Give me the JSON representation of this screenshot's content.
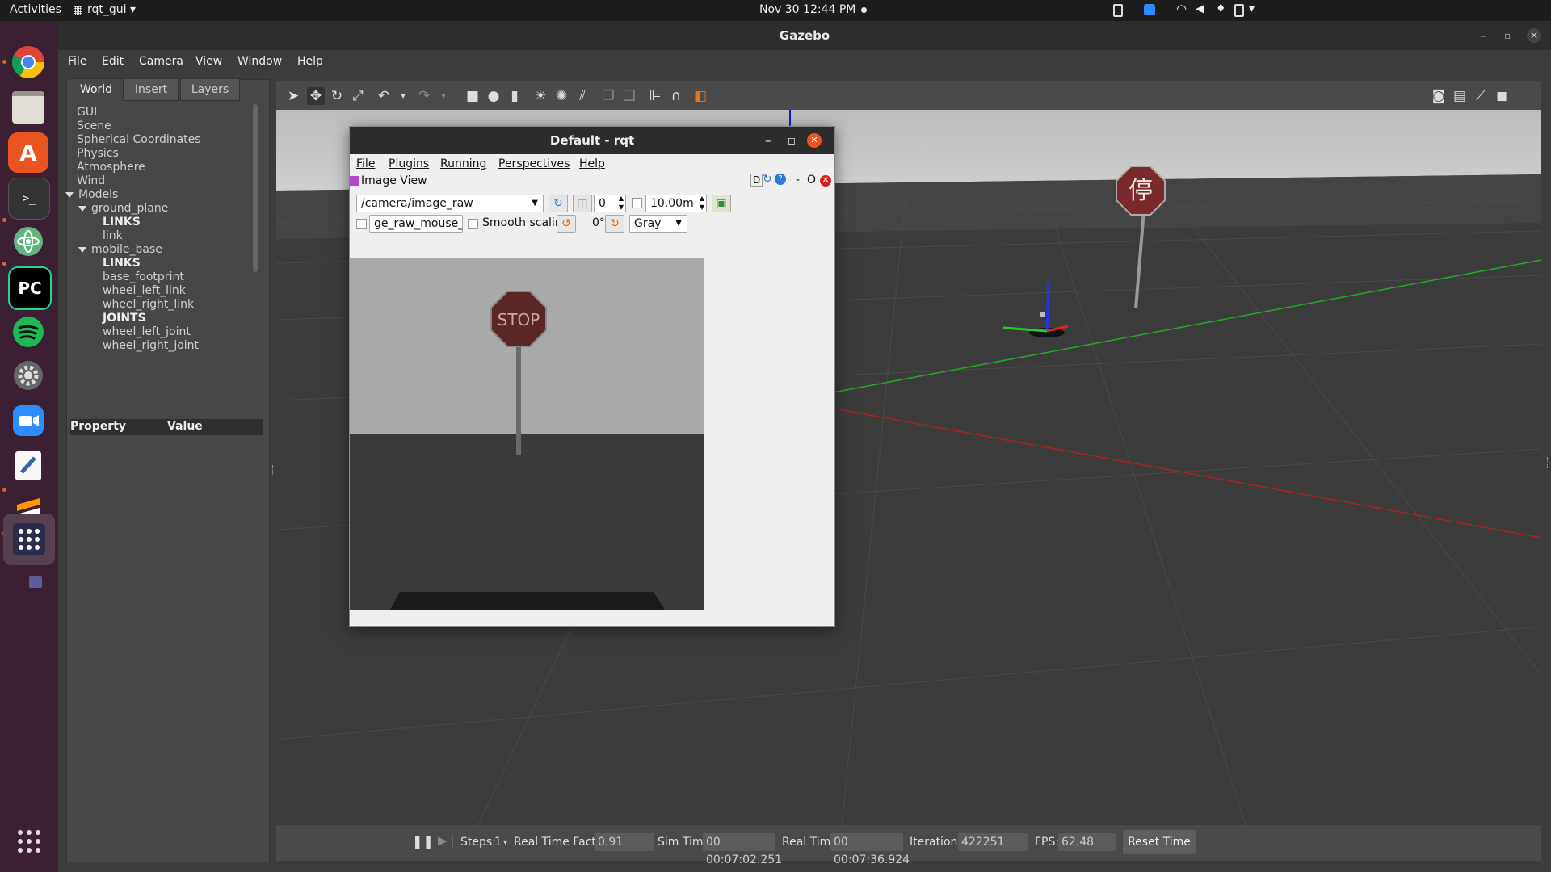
{
  "topbar": {
    "activities": "Activities",
    "app_menu": "rqt_gui ▾",
    "clock": "Nov 30  12:44 PM"
  },
  "dock": {
    "apps": [
      {
        "name": "chrome",
        "icon": "chrome-icon"
      },
      {
        "name": "files",
        "icon": "files-icon"
      },
      {
        "name": "software",
        "icon": "software-center-icon"
      },
      {
        "name": "terminal",
        "icon": "terminal-icon"
      },
      {
        "name": "atom",
        "icon": "atom-icon"
      },
      {
        "name": "pycharm",
        "icon": "pycharm-icon"
      },
      {
        "name": "spotify",
        "icon": "spotify-icon"
      },
      {
        "name": "settings",
        "icon": "settings-icon"
      },
      {
        "name": "zoom",
        "icon": "zoom-icon"
      },
      {
        "name": "text-editor",
        "icon": "text-editor-icon"
      },
      {
        "name": "sublime",
        "icon": "sublime-icon"
      },
      {
        "name": "rqt",
        "icon": "rqt-icon"
      }
    ],
    "show_apps": "show-apps-icon"
  },
  "gazebo": {
    "title": "Gazebo",
    "menu": [
      "File",
      "Edit",
      "Camera",
      "View",
      "Window",
      "Help"
    ],
    "tabs": [
      "World",
      "Insert",
      "Layers"
    ],
    "tree": [
      {
        "label": "GUI",
        "level": 0
      },
      {
        "label": "Scene",
        "level": 0
      },
      {
        "label": "Spherical Coordinates",
        "level": 0
      },
      {
        "label": "Physics",
        "level": 0
      },
      {
        "label": "Atmosphere",
        "level": 0
      },
      {
        "label": "Wind",
        "level": 0
      },
      {
        "label": "Models",
        "level": 0,
        "expanded": true
      },
      {
        "label": "ground_plane",
        "level": 1,
        "expanded": true
      },
      {
        "label": "LINKS",
        "level": 2,
        "bold": true
      },
      {
        "label": "link",
        "level": 2
      },
      {
        "label": "mobile_base",
        "level": 1,
        "expanded": true
      },
      {
        "label": "LINKS",
        "level": 2,
        "bold": true
      },
      {
        "label": "base_footprint",
        "level": 2
      },
      {
        "label": "wheel_left_link",
        "level": 2
      },
      {
        "label": "wheel_right_link",
        "level": 2
      },
      {
        "label": "JOINTS",
        "level": 2,
        "bold": true
      },
      {
        "label": "wheel_left_joint",
        "level": 2
      },
      {
        "label": "wheel_right_joint",
        "level": 2
      }
    ],
    "property_header": {
      "property": "Property",
      "value": "Value"
    },
    "stop_sign_text": "停",
    "bottom": {
      "steps_label": "Steps:",
      "steps_value": "1",
      "rtf_label": "Real Time Factor:",
      "rtf_value": "0.91",
      "sim_label": "Sim Time:",
      "sim_value": "00 00:07:02.251",
      "real_label": "Real Time:",
      "real_value": "00 00:07:36.924",
      "iter_label": "Iterations:",
      "iter_value": "422251",
      "fps_label": "FPS:",
      "fps_value": "62.48",
      "reset_label": "Reset Time"
    }
  },
  "rqt": {
    "title": "Default - rqt",
    "menu": [
      "File",
      "Plugins",
      "Running",
      "Perspectives",
      "Help"
    ],
    "plugin_title": "Image View",
    "plugin_controls": "D",
    "topic": "/camera/image_raw",
    "spin_value": "0",
    "distance_value": "10.00m",
    "mouse_topic": "ge_raw_mouse_left",
    "smooth_label": "Smooth scaling",
    "rotation": "0°",
    "colormap": "Gray",
    "stop_text": "STOP"
  }
}
